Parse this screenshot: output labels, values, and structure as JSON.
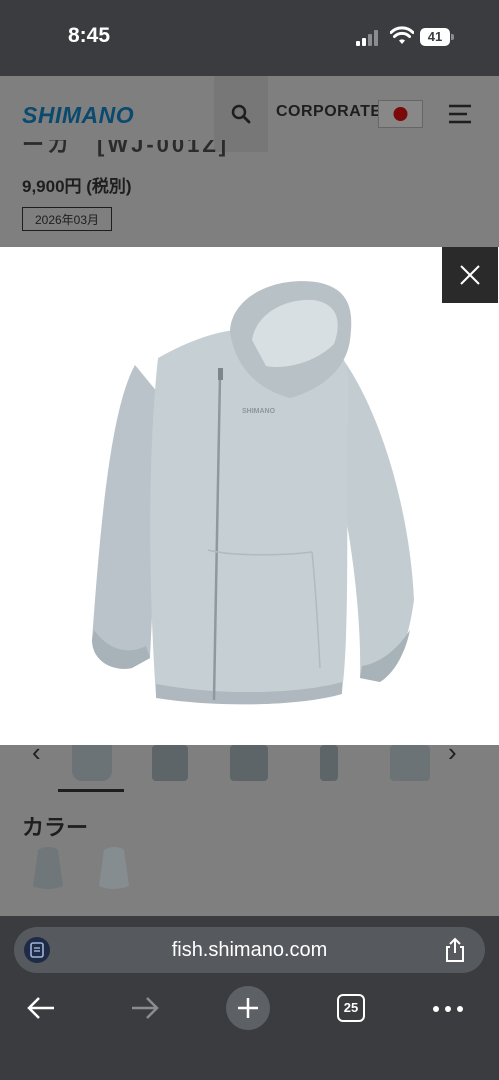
{
  "status_bar": {
    "time": "8:45",
    "battery": "41"
  },
  "header": {
    "logo": "SHIMANO",
    "corporate": "CORPORATE"
  },
  "product": {
    "title_partial": "ーカ　[WJ-001Z]",
    "price": "9,900円 (税別)",
    "release": "2026年03月",
    "jacket_logo": "SHIMANO"
  },
  "thumbnails": {
    "count": 5
  },
  "color_section": {
    "heading": "カラー"
  },
  "browser": {
    "url": "fish.shimano.com",
    "tab_count": "25"
  }
}
